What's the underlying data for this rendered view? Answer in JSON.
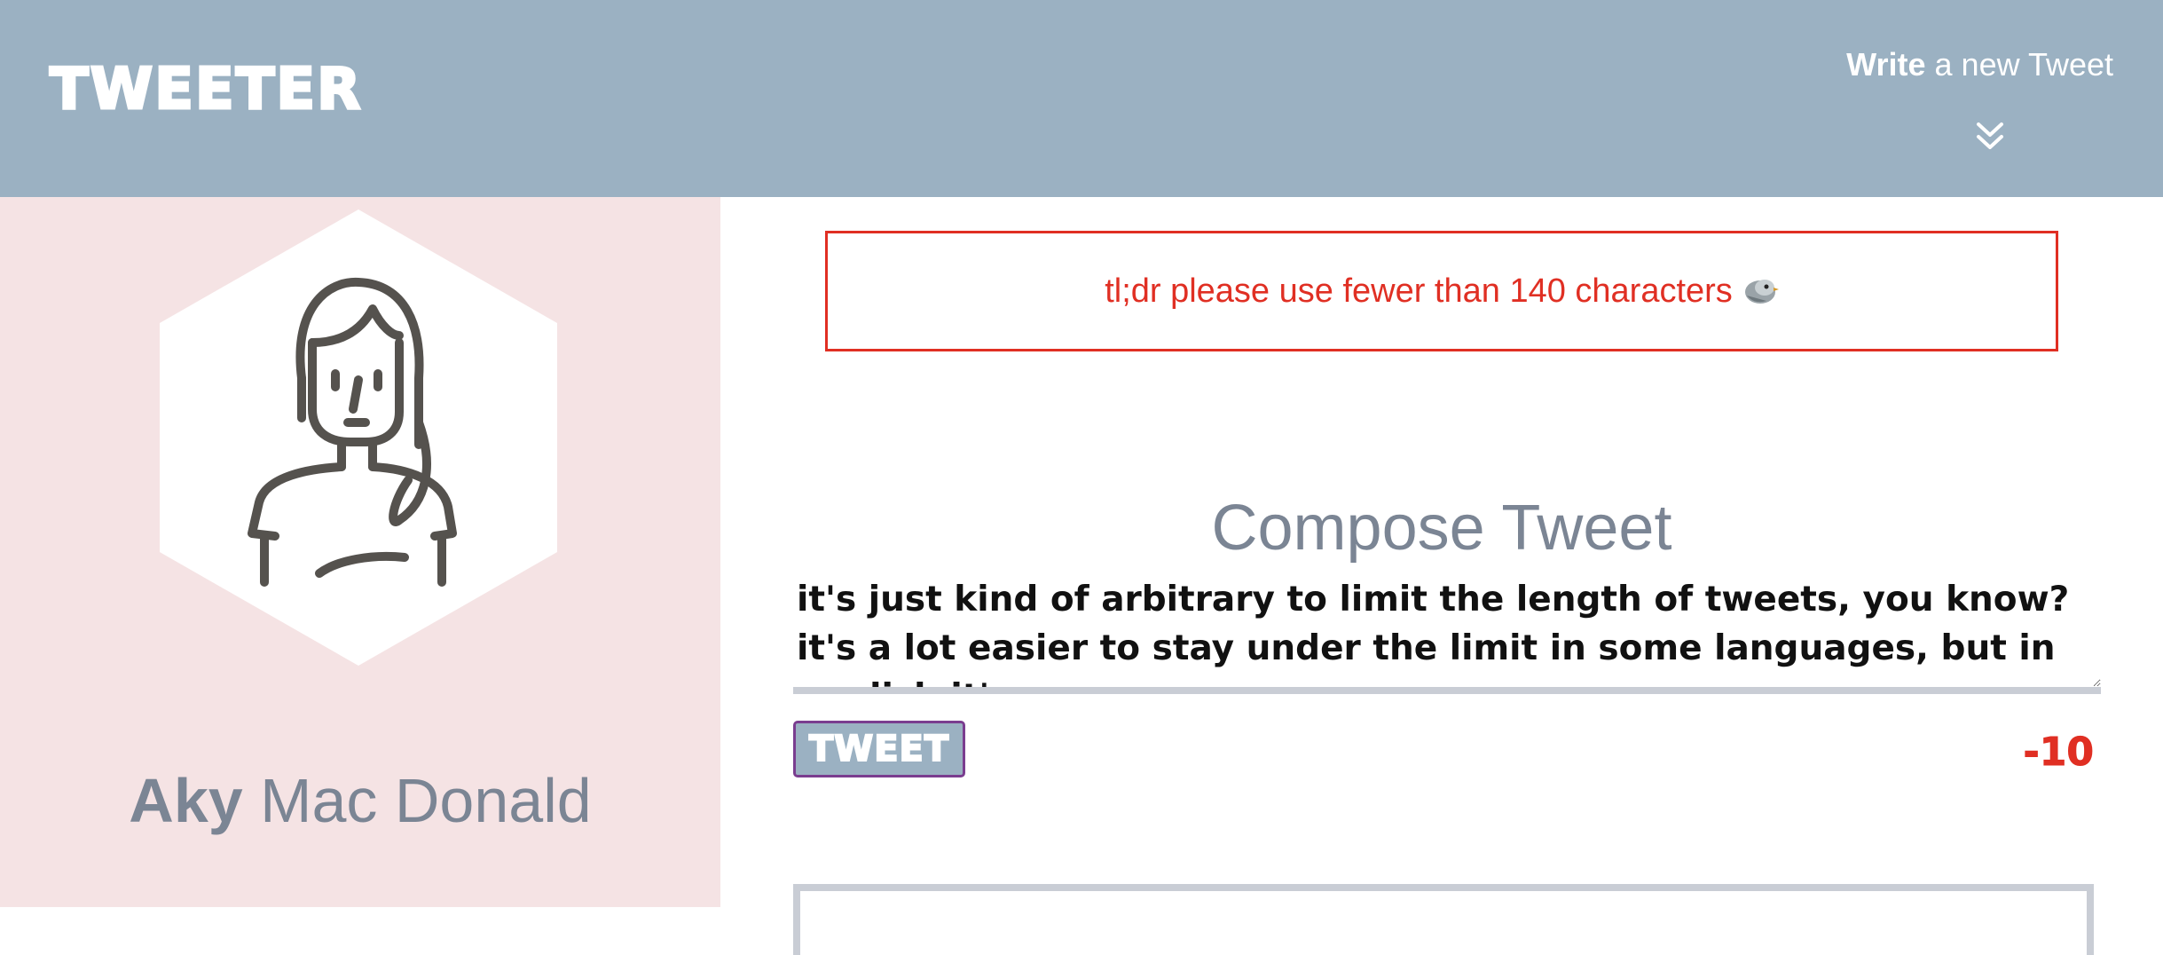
{
  "navbar": {
    "brand": "TWEETER",
    "write_bold": "Write",
    "write_rest": " a new Tweet",
    "toggle_icon": "double-chevron-down-icon"
  },
  "profile": {
    "avatar_icon": "woman-avatar-icon",
    "first_name": "Aky",
    "last_name": " Mac Donald"
  },
  "compose": {
    "error_message": "tl;dr please use fewer than 140 characters",
    "error_icon": "bird-icon",
    "title": "Compose Tweet",
    "text": "it's just kind of arbitrary to limit the length of tweets, you know? it's a lot easier to stay under the limit in some languages, but in english it's",
    "button_label": "TWEET",
    "counter": "-10"
  },
  "colors": {
    "navbar_bg": "#9bb1c2",
    "profile_bg": "#f5e3e4",
    "error": "#e02f23",
    "muted_text": "#7b8594",
    "button_border": "#7a3d8f"
  }
}
